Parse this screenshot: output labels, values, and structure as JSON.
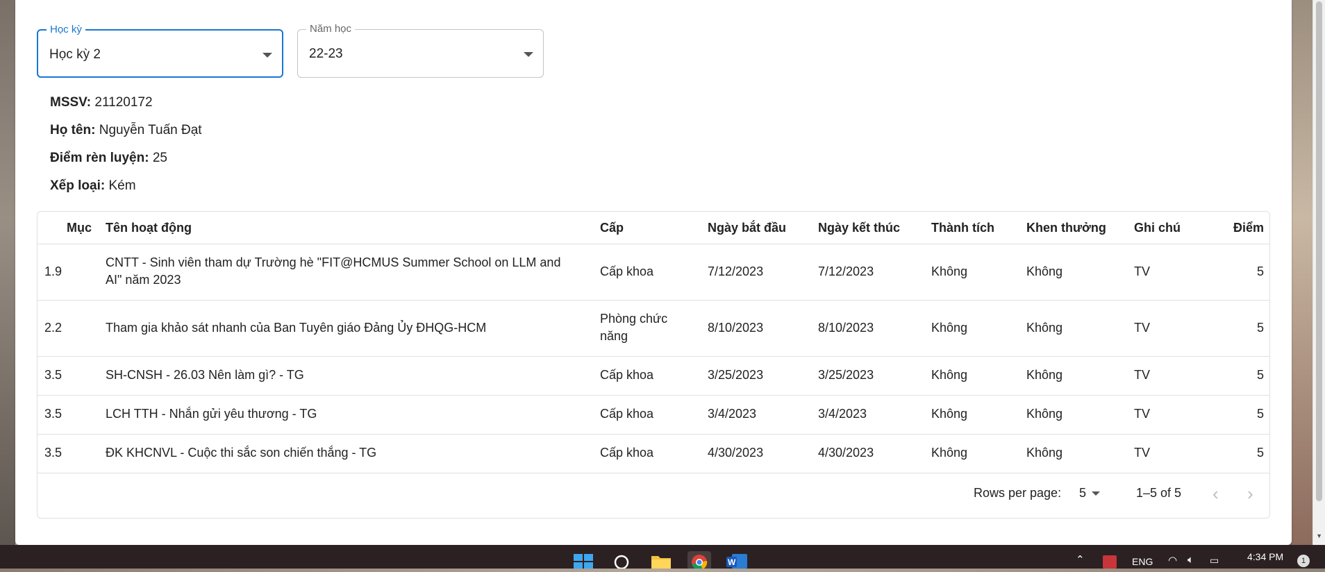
{
  "filters": {
    "semester": {
      "label": "Học kỳ",
      "value": "Học kỳ 2"
    },
    "year": {
      "label": "Năm học",
      "value": "22-23"
    }
  },
  "student": {
    "id_label": "MSSV:",
    "id": "21120172",
    "name_label": "Họ tên:",
    "name": "Nguyễn Tuấn Đạt",
    "score_label": "Điểm rèn luyện:",
    "score": "25",
    "rank_label": "Xếp loại:",
    "rank": "Kém"
  },
  "table": {
    "headers": [
      "Mục",
      "Tên hoạt động",
      "Cấp",
      "Ngày bắt đầu",
      "Ngày kết thúc",
      "Thành tích",
      "Khen thưởng",
      "Ghi chú",
      "Điểm"
    ],
    "rows": [
      [
        "1.9",
        "CNTT - Sinh viên tham dự Trường hè \"FIT@HCMUS Summer School on LLM and AI\" năm 2023",
        "Cấp khoa",
        "7/12/2023",
        "7/12/2023",
        "Không",
        "Không",
        "TV",
        "5"
      ],
      [
        "2.2",
        "Tham gia khảo sát nhanh của Ban Tuyên giáo Đảng Ủy ĐHQG-HCM",
        "Phòng chức năng",
        "8/10/2023",
        "8/10/2023",
        "Không",
        "Không",
        "TV",
        "5"
      ],
      [
        "3.5",
        "SH-CNSH - 26.03 Nên làm gì? - TG",
        "Cấp khoa",
        "3/25/2023",
        "3/25/2023",
        "Không",
        "Không",
        "TV",
        "5"
      ],
      [
        "3.5",
        "LCH TTH - Nhắn gửi yêu thương - TG",
        "Cấp khoa",
        "3/4/2023",
        "3/4/2023",
        "Không",
        "Không",
        "TV",
        "5"
      ],
      [
        "3.5",
        "ĐK KHCNVL - Cuộc thi sắc son chiến thắng - TG",
        "Cấp khoa",
        "4/30/2023",
        "4/30/2023",
        "Không",
        "Không",
        "TV",
        "5"
      ]
    ]
  },
  "pagination": {
    "rows_per_page_label": "Rows per page:",
    "rows_per_page": "5",
    "range": "1–5 of 5"
  },
  "taskbar": {
    "language": "ENG",
    "time": "4:34 PM",
    "notification_count": "1"
  },
  "colors": {
    "accent": "#1976d2",
    "taskbar": "#2b2123"
  }
}
